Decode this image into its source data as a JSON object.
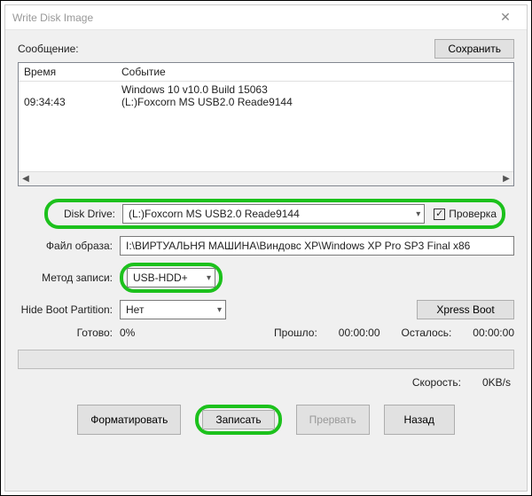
{
  "title": "Write Disk Image",
  "message_label": "Сообщение:",
  "save_btn": "Сохранить",
  "log": {
    "headers": {
      "time": "Время",
      "event": "Событие"
    },
    "rows": [
      {
        "time": "",
        "event": "Windows 10 v10.0 Build 15063"
      },
      {
        "time": "09:34:43",
        "event": "(L:)Foxcorn MS  USB2.0 Reade9144"
      }
    ]
  },
  "form": {
    "disk_drive_label": "Disk Drive:",
    "disk_drive_value": "(L:)Foxcorn MS  USB2.0 Reade9144",
    "verify_label": "Проверка",
    "image_file_label": "Файл образа:",
    "image_file_value": "I:\\ВИРТУАЛЬНЯ МАШИНА\\Виндовс ХР\\Windows XP Pro SP3 Final x86",
    "write_method_label": "Метод записи:",
    "write_method_value": "USB-HDD+",
    "hide_boot_label": "Hide Boot Partition:",
    "hide_boot_value": "Нет",
    "xpress_boot_btn": "Xpress Boot"
  },
  "progress": {
    "ready_label": "Готово:",
    "percent": "0%",
    "elapsed_label": "Прошло:",
    "elapsed_value": "00:00:00",
    "remaining_label": "Осталось:",
    "remaining_value": "00:00:00",
    "speed_label": "Скорость:",
    "speed_value": "0KB/s"
  },
  "buttons": {
    "format": "Форматировать",
    "write": "Записать",
    "abort": "Прервать",
    "back": "Назад"
  }
}
